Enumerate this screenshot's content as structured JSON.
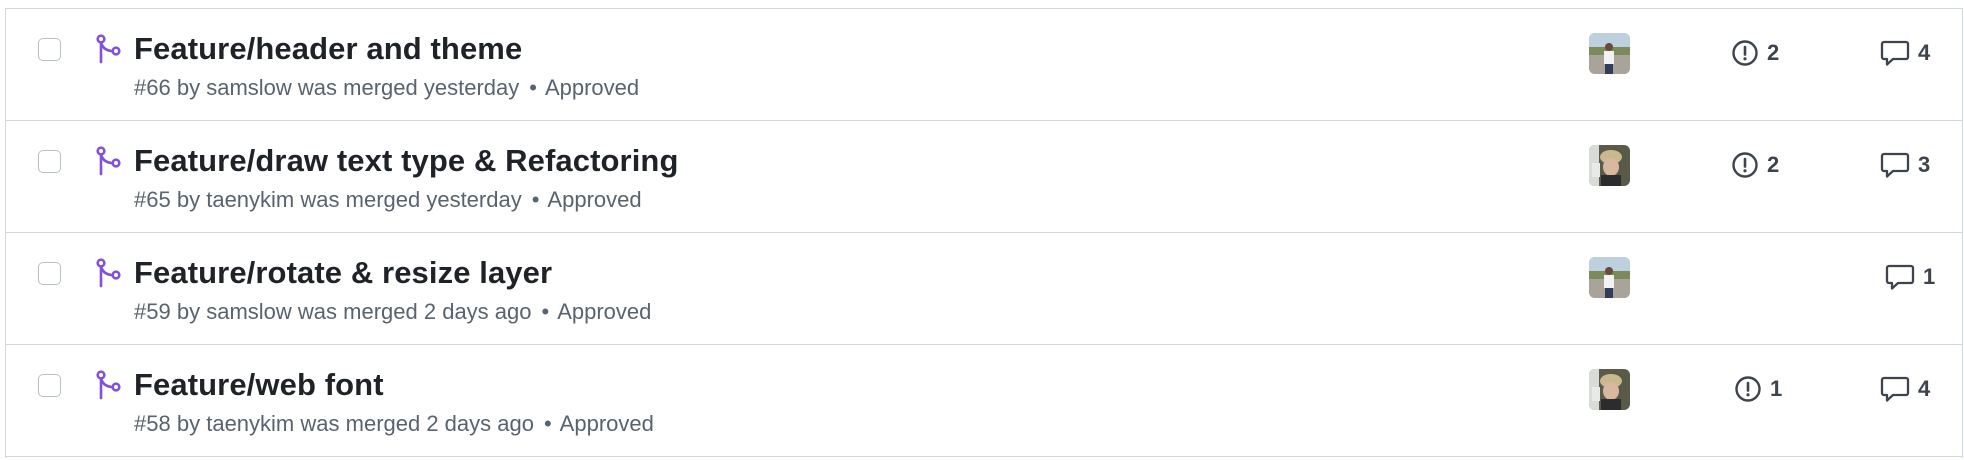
{
  "pull_requests": [
    {
      "title": "Feature/header and theme",
      "number": "#66",
      "by": "by",
      "author": "samslow",
      "merged_text": "was merged yesterday",
      "separator": "•",
      "review": "Approved",
      "avatar": "samslow-avatar",
      "issues": "2",
      "comments": "4"
    },
    {
      "title": "Feature/draw text type & Refactoring",
      "number": "#65",
      "by": "by",
      "author": "taenykim",
      "merged_text": "was merged yesterday",
      "separator": "•",
      "review": "Approved",
      "avatar": "taenykim-avatar",
      "issues": "2",
      "comments": "3"
    },
    {
      "title": "Feature/rotate & resize layer",
      "number": "#59",
      "by": "by",
      "author": "samslow",
      "merged_text": "was merged 2 days ago",
      "separator": "•",
      "review": "Approved",
      "avatar": "samslow-avatar",
      "issues": "",
      "comments": "1"
    },
    {
      "title": "Feature/web font",
      "number": "#58",
      "by": "by",
      "author": "taenykim",
      "merged_text": "was merged 2 days ago",
      "separator": "•",
      "review": "Approved",
      "avatar": "taenykim-avatar",
      "issues": "1",
      "comments": "4"
    }
  ],
  "colors": {
    "merged_purple": "#8250df",
    "border": "#d0d7de",
    "muted_text": "#59636e",
    "title_text": "#1f2328"
  },
  "icons": {
    "merged": "git-merge-icon",
    "issue": "issue-opened-icon",
    "comment": "comment-icon"
  }
}
